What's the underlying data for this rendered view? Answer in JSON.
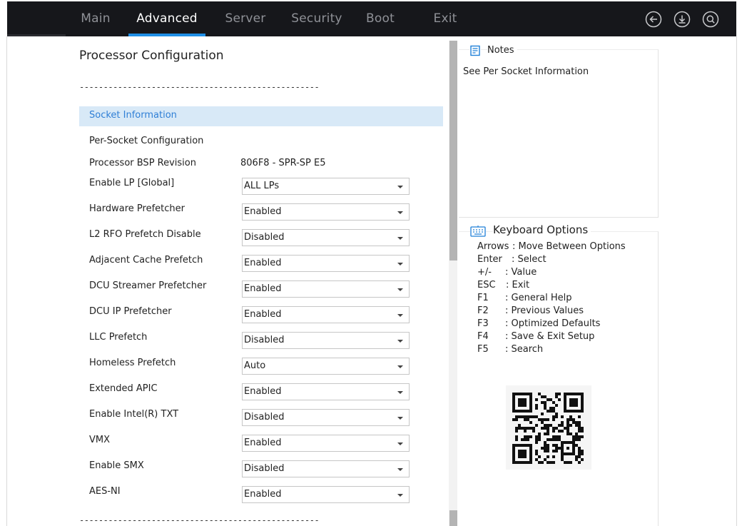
{
  "nav": {
    "tabs": [
      {
        "label": "Main",
        "active": false
      },
      {
        "label": "Advanced",
        "active": true
      },
      {
        "label": "Server",
        "active": false
      },
      {
        "label": "Security",
        "active": false
      },
      {
        "label": "Boot",
        "active": false
      },
      {
        "label": "Exit",
        "active": false
      }
    ],
    "icons": [
      "back-icon",
      "download-icon",
      "search-icon"
    ],
    "accent_color": "#1f8fe6",
    "bar_color": "#16171b"
  },
  "main": {
    "title": "Processor Configuration",
    "divider": "--------------------------------------------------",
    "section_link": "Socket Information",
    "subheading": "Per-Socket Configuration",
    "info_rows": [
      {
        "label": "Processor BSP Revision",
        "value": "806F8 - SPR-SP E5"
      }
    ],
    "settings": [
      {
        "label": "Enable LP [Global]",
        "value": "ALL LPs"
      },
      {
        "label": "Hardware Prefetcher",
        "value": "Enabled"
      },
      {
        "label": "L2 RFO Prefetch Disable",
        "value": "Disabled"
      },
      {
        "label": "Adjacent Cache Prefetch",
        "value": "Enabled"
      },
      {
        "label": "DCU Streamer Prefetcher",
        "value": "Enabled"
      },
      {
        "label": "DCU IP Prefetcher",
        "value": "Enabled"
      },
      {
        "label": "LLC Prefetch",
        "value": "Disabled"
      },
      {
        "label": "Homeless Prefetch",
        "value": "Auto"
      },
      {
        "label": "Extended APIC",
        "value": "Enabled"
      },
      {
        "label": "Enable Intel(R) TXT",
        "value": "Disabled"
      },
      {
        "label": "VMX",
        "value": "Enabled"
      },
      {
        "label": "Enable SMX",
        "value": "Disabled"
      },
      {
        "label": "AES-NI",
        "value": "Enabled"
      }
    ]
  },
  "notes": {
    "title": "Notes",
    "text": "See Per Socket Information"
  },
  "keyboard": {
    "title": "Keyboard Options",
    "options": [
      {
        "key": "Arrows",
        "desc": ": Move Between Options"
      },
      {
        "key": "Enter",
        "desc": ": Select"
      },
      {
        "key": "+/-",
        "desc": ": Value"
      },
      {
        "key": "ESC",
        "desc": ": Exit"
      },
      {
        "key": "F1",
        "desc": ": General Help"
      },
      {
        "key": "F2",
        "desc": ": Previous Values"
      },
      {
        "key": "F3",
        "desc": ": Optimized Defaults"
      },
      {
        "key": "F4",
        "desc": ": Save & Exit Setup"
      },
      {
        "key": "F5",
        "desc": ": Search"
      }
    ]
  }
}
